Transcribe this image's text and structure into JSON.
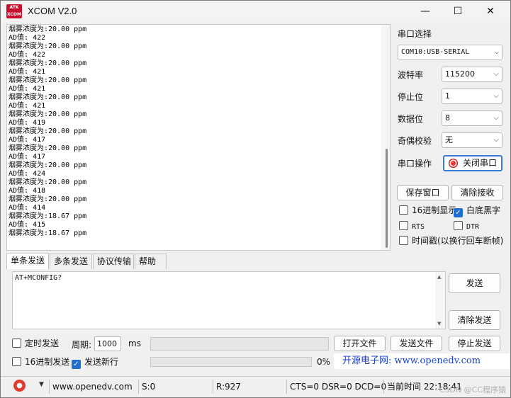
{
  "window": {
    "title": "XCOM V2.0",
    "logo_text": "ATK XCOM",
    "minimize_glyph": "—",
    "maximize_glyph": "☐",
    "close_glyph": "✕"
  },
  "receive": {
    "lines": [
      "烟雾浓度为:20.00 ppm",
      "AD值: 422",
      "烟雾浓度为:20.00 ppm",
      "AD值: 422",
      "烟雾浓度为:20.00 ppm",
      "AD值: 421",
      "烟雾浓度为:20.00 ppm",
      "AD值: 421",
      "烟雾浓度为:20.00 ppm",
      "AD值: 421",
      "烟雾浓度为:20.00 ppm",
      "AD值: 419",
      "烟雾浓度为:20.00 ppm",
      "AD值: 417",
      "烟雾浓度为:20.00 ppm",
      "AD值: 417",
      "烟雾浓度为:20.00 ppm",
      "AD值: 424",
      "烟雾浓度为:20.00 ppm",
      "AD值: 418",
      "烟雾浓度为:20.00 ppm",
      "AD值: 414",
      "烟雾浓度为:18.67 ppm",
      "AD值: 415",
      "烟雾浓度为:18.67 ppm"
    ]
  },
  "serial": {
    "port_label": "串口选择",
    "port_value": "COM10:USB-SERIAL",
    "baud_label": "波特率",
    "baud_value": "115200",
    "stop_label": "停止位",
    "stop_value": "1",
    "data_label": "数据位",
    "data_value": "8",
    "parity_label": "奇偶校验",
    "parity_value": "无",
    "op_label": "串口操作",
    "op_button": "关闭串口"
  },
  "recv_controls": {
    "save_window": "保存窗口",
    "clear_receive": "清除接收",
    "hex_display": "16进制显示",
    "hex_display_checked": false,
    "white_black": "白底黑字",
    "white_black_checked": true,
    "rts": "RTS",
    "rts_checked": false,
    "dtr": "DTR",
    "dtr_checked": false,
    "timestamp": "时间戳(以换行回车断帧)",
    "timestamp_checked": false
  },
  "tabs": [
    "单条发送",
    "多条发送",
    "协议传输",
    "帮助"
  ],
  "send": {
    "text": "AT+MCONFIG?",
    "send_button": "发送",
    "clear_send_button": "清除发送",
    "timed_send": "定时发送",
    "timed_send_checked": false,
    "period_label": "周期:",
    "period_value": "1000",
    "period_unit": "ms",
    "open_file": "打开文件",
    "send_file": "发送文件",
    "stop_send": "停止发送",
    "hex_send": "16进制发送",
    "hex_send_checked": false,
    "newline": "发送新行",
    "newline_checked": true,
    "progress_text": "0%",
    "progress_value": 0,
    "site": "开源电子网: www.openedv.com"
  },
  "status": {
    "url": "www.openedv.com",
    "sent": "S:0",
    "received": "R:927",
    "lines": "CTS=0 DSR=0 DCD=0",
    "time": "当前时间 22:18:41",
    "watermark": "CSDN @CC程序猿"
  },
  "colors": {
    "accent": "#1f6fd1",
    "link": "#1a3ec8",
    "led": "#e23b2d"
  }
}
